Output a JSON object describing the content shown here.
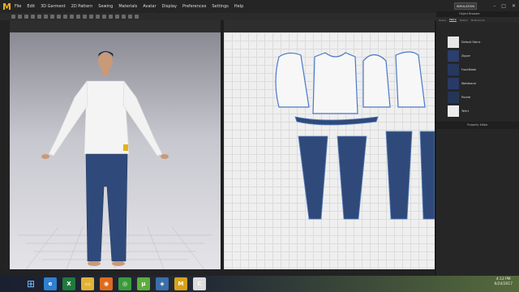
{
  "app": {
    "logo_letter": "M",
    "accent": "#f3b21b"
  },
  "menu": [
    "File",
    "Edit",
    "3D Garment",
    "2D Pattern",
    "Sewing",
    "Materials",
    "Avatar",
    "Display",
    "Preferences",
    "Settings",
    "Help"
  ],
  "toolbar": {
    "simulation_label": "SIMULATION"
  },
  "right_panel": {
    "title": "Object Browser",
    "tabs": [
      "Scene",
      "Fabric",
      "Button",
      "Buttonhole"
    ],
    "active_tab": "Fabric",
    "fabrics": [
      {
        "name": "Default Fabric",
        "color": "#e6e6e6"
      },
      {
        "name": "Zipper",
        "color": "#2c3e6b"
      },
      {
        "name": "FrontBlade",
        "color": "#263860"
      },
      {
        "name": "Waistband",
        "color": "#2a3a66"
      },
      {
        "name": "Pocket",
        "color": "#253556"
      },
      {
        "name": "Tshirt",
        "color": "#ececec"
      }
    ],
    "property_editor": "Property Editor"
  },
  "clock": {
    "time": "4:12 PM",
    "date": "6/24/2017"
  },
  "taskbar_icons": [
    {
      "name": "internet-explorer-icon",
      "glyph": "e",
      "color": "#2f7fd1"
    },
    {
      "name": "excel-icon",
      "glyph": "X",
      "color": "#1f7a3b"
    },
    {
      "name": "file-explorer-icon",
      "glyph": "▭",
      "color": "#e0b23a"
    },
    {
      "name": "firefox-icon",
      "glyph": "◉",
      "color": "#e06a1c"
    },
    {
      "name": "chrome-icon",
      "glyph": "◎",
      "color": "#3a9b3a"
    },
    {
      "name": "utorrent-icon",
      "glyph": "μ",
      "color": "#5cae3a"
    },
    {
      "name": "app-icon",
      "glyph": "◈",
      "color": "#3a6fa8"
    },
    {
      "name": "marvelous-icon",
      "glyph": "M",
      "color": "#d8a21a"
    },
    {
      "name": "clo-icon",
      "glyph": "C",
      "color": "#dcdcdc"
    }
  ]
}
